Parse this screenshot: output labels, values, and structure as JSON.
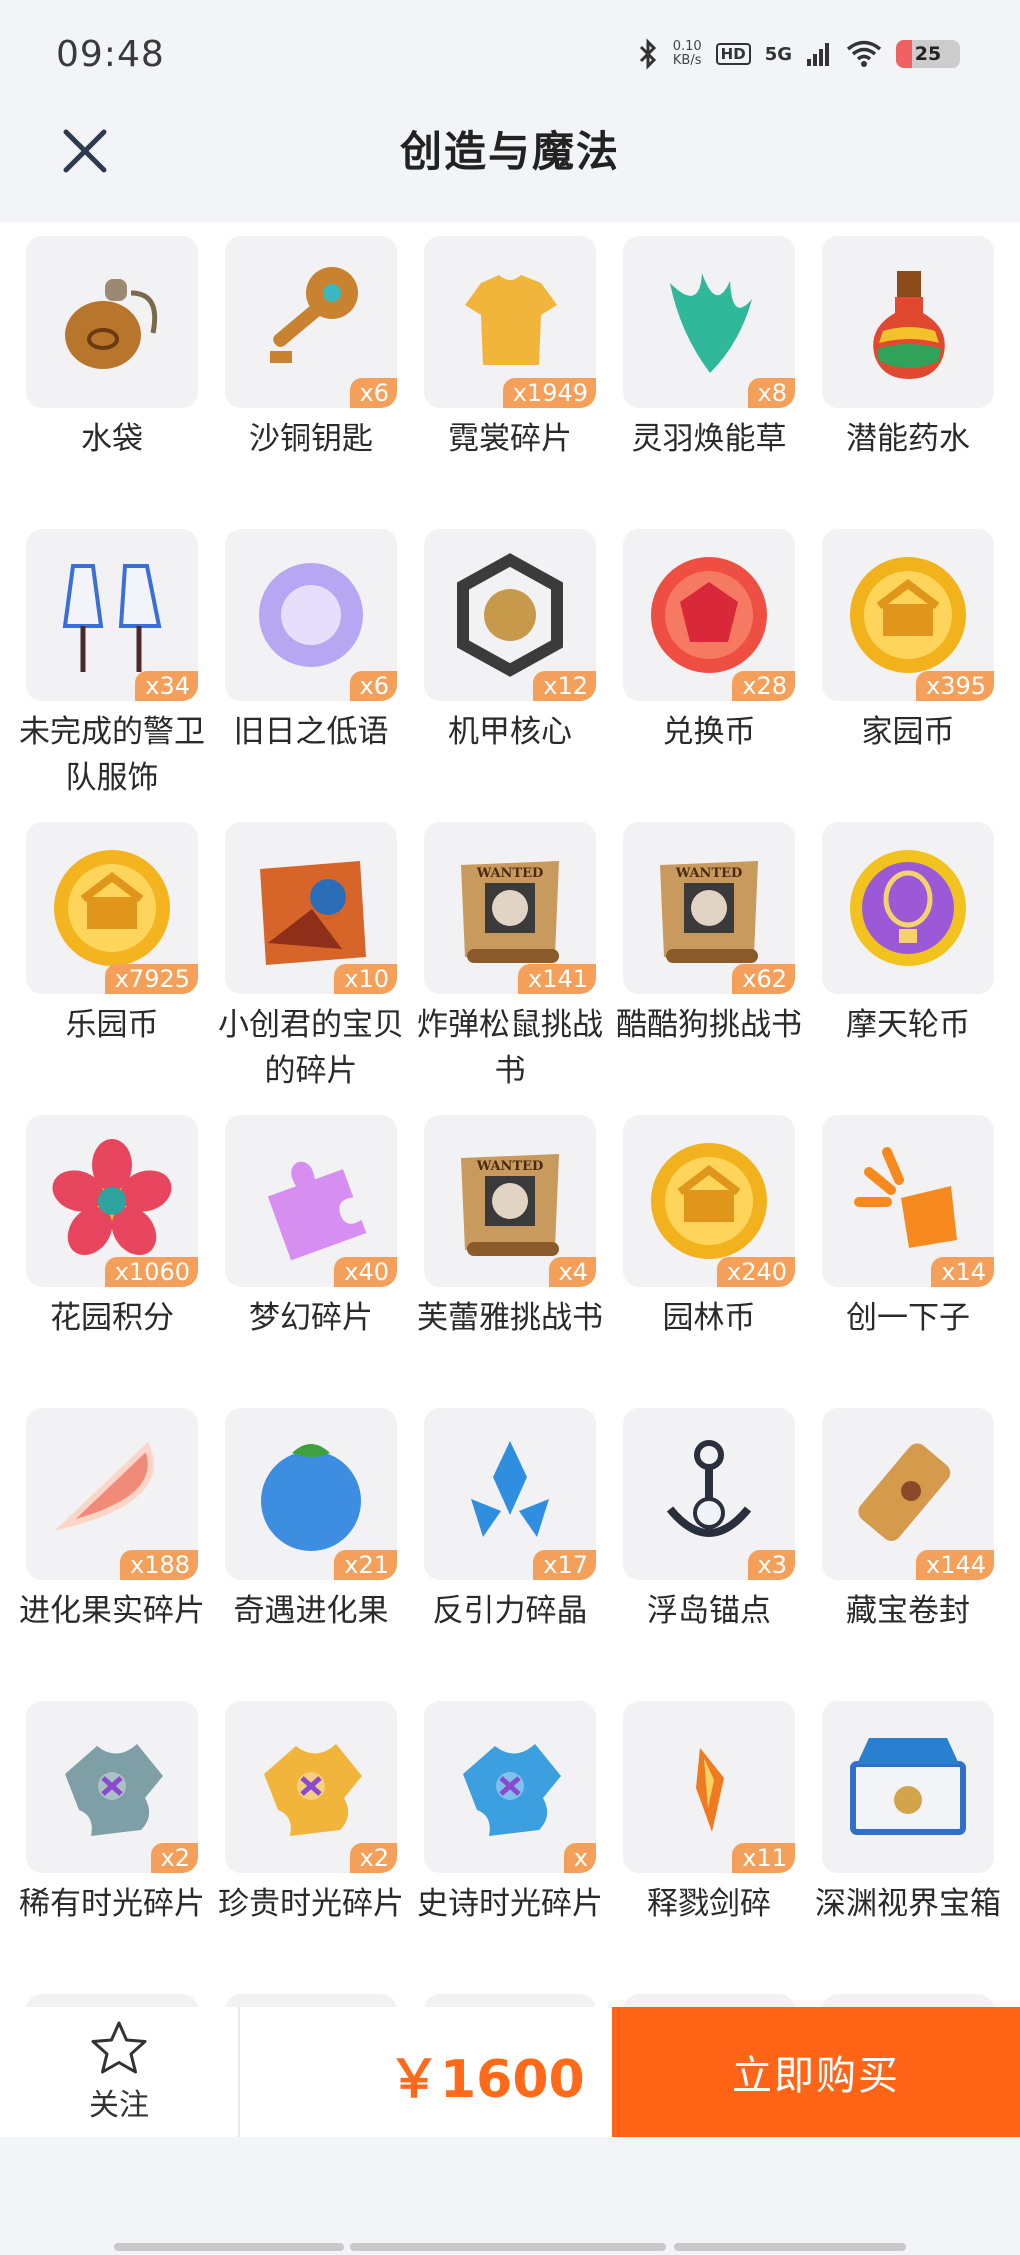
{
  "status_bar": {
    "time": "09:48",
    "net_speed_value": "0.10",
    "net_speed_unit": "KB/s",
    "hd_label": "HD",
    "network_label": "5G",
    "battery_level": "25",
    "battery_fraction": 0.25
  },
  "header": {
    "title": "创造与魔法"
  },
  "items": [
    {
      "name": "水袋",
      "qty": "",
      "icon": "water-pouch",
      "color": "#b8752c"
    },
    {
      "name": "沙铜钥匙",
      "qty": "x6",
      "icon": "key",
      "color": "#c9822f"
    },
    {
      "name": "霓裳碎片",
      "qty": "x1949",
      "icon": "shirt",
      "color": "#f2b53b"
    },
    {
      "name": "灵羽焕能草",
      "qty": "x8",
      "icon": "herb",
      "color": "#2fb89a"
    },
    {
      "name": "潜能药水",
      "qty": "",
      "icon": "potion",
      "color": "#e0482f"
    },
    {
      "name": "未完成的警卫队服饰",
      "qty": "x34",
      "icon": "outfit",
      "color": "#3a6fd8"
    },
    {
      "name": "旧日之低语",
      "qty": "x6",
      "icon": "orb",
      "color": "#b7a6f2"
    },
    {
      "name": "机甲核心",
      "qty": "x12",
      "icon": "mech-core",
      "color": "#3b3b3b"
    },
    {
      "name": "兑换币",
      "qty": "x28",
      "icon": "coin-gem",
      "color": "#ef4f43"
    },
    {
      "name": "家园币",
      "qty": "x395",
      "icon": "coin-home",
      "color": "#f1b21c"
    },
    {
      "name": "乐园币",
      "qty": "x7925",
      "icon": "coin-park",
      "color": "#f3b41f"
    },
    {
      "name": "小创君的宝贝的碎片",
      "qty": "x10",
      "icon": "puzzle-photo",
      "color": "#d7652a"
    },
    {
      "name": "炸弹松鼠挑战书",
      "qty": "x141",
      "icon": "wanted-scroll",
      "color": "#c99a5d"
    },
    {
      "name": "酷酷狗挑战书",
      "qty": "x62",
      "icon": "wanted-scroll",
      "color": "#c99a5d"
    },
    {
      "name": "摩天轮币",
      "qty": "",
      "icon": "coin-balloon",
      "color": "#9b59d8"
    },
    {
      "name": "花园积分",
      "qty": "x1060",
      "icon": "flower-badge",
      "color": "#e8465e"
    },
    {
      "name": "梦幻碎片",
      "qty": "x40",
      "icon": "puzzle-piece",
      "color": "#d68ef0"
    },
    {
      "name": "芙蕾雅挑战书",
      "qty": "x4",
      "icon": "wanted-scroll",
      "color": "#c99a5d"
    },
    {
      "name": "园林币",
      "qty": "x240",
      "icon": "coin-garden",
      "color": "#f2b21e"
    },
    {
      "name": "创一下子",
      "qty": "x14",
      "icon": "burst",
      "color": "#f78a1e"
    },
    {
      "name": "进化果实碎片",
      "qty": "x188",
      "icon": "fruit-slice",
      "color": "#f08b7a"
    },
    {
      "name": "奇遇进化果",
      "qty": "x21",
      "icon": "berry",
      "color": "#3d8ee0"
    },
    {
      "name": "反引力碎晶",
      "qty": "x17",
      "icon": "crystal",
      "color": "#2f8ee0"
    },
    {
      "name": "浮岛锚点",
      "qty": "x3",
      "icon": "anchor",
      "color": "#2a2f3c"
    },
    {
      "name": "藏宝卷封",
      "qty": "x144",
      "icon": "scroll-tube",
      "color": "#d59a4b"
    },
    {
      "name": "稀有时光碎片",
      "qty": "x2",
      "icon": "time-shard",
      "color": "#7f9fa7"
    },
    {
      "name": "珍贵时光碎片",
      "qty": "x2",
      "icon": "time-shard",
      "color": "#f0b53a"
    },
    {
      "name": "史诗时光碎片",
      "qty": "x",
      "icon": "time-shard",
      "color": "#3c9fe0"
    },
    {
      "name": "释戮剑碎",
      "qty": "x11",
      "icon": "sword-shard",
      "color": "#f07a1f"
    },
    {
      "name": "深渊视界宝箱",
      "qty": "",
      "icon": "chest",
      "color": "#2f6fc8"
    },
    {
      "name": "",
      "qty": "",
      "icon": "gem",
      "color": "#b43ad6"
    },
    {
      "name": "",
      "qty": "",
      "icon": "gem",
      "color": "#b43ad6"
    },
    {
      "name": "",
      "qty": "",
      "icon": "gem",
      "color": "#b43ad6"
    },
    {
      "name": "",
      "qty": "",
      "icon": "gem",
      "color": "#b43ad6"
    },
    {
      "name": "",
      "qty": "",
      "icon": "gem",
      "color": "#b43ad6"
    }
  ],
  "bottom_bar": {
    "follow_label": "关注",
    "price": "￥1600",
    "buy_label": "立即购买",
    "accent": "#ff6417"
  }
}
